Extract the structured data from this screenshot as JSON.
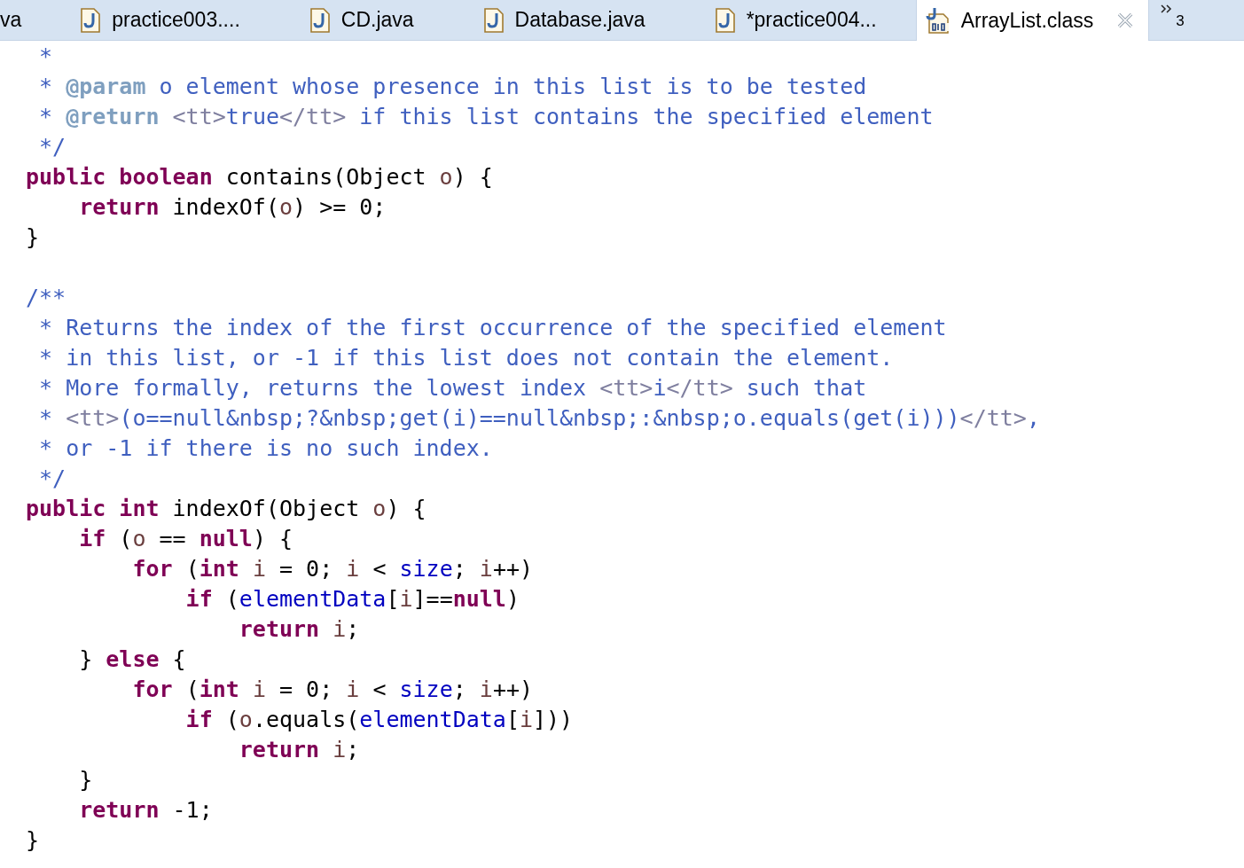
{
  "tabs": [
    {
      "label": "va",
      "kind": "cut",
      "selected": false
    },
    {
      "label": "practice003....",
      "kind": "java",
      "selected": false
    },
    {
      "label": "CD.java",
      "kind": "java",
      "selected": false
    },
    {
      "label": "Database.java",
      "kind": "java",
      "selected": false
    },
    {
      "label": "*practice004...",
      "kind": "java",
      "selected": false
    },
    {
      "label": "ArrayList.class",
      "kind": "class",
      "selected": true
    }
  ],
  "overflow": {
    "count": "3"
  },
  "editor": {
    "lines": [
      {
        "kind": "code",
        "tokens": [
          {
            "kind": "comment",
            "text": " *"
          }
        ]
      },
      {
        "kind": "code",
        "tokens": [
          {
            "kind": "comment",
            "text": " * "
          },
          {
            "kind": "doctag",
            "text": "@param"
          },
          {
            "kind": "comment",
            "text": " o element whose presence in this list is to be tested"
          }
        ]
      },
      {
        "kind": "code",
        "tokens": [
          {
            "kind": "comment",
            "text": " * "
          },
          {
            "kind": "doctag",
            "text": "@return"
          },
          {
            "kind": "html",
            "text": " <tt>"
          },
          {
            "kind": "comment",
            "text": "true"
          },
          {
            "kind": "html",
            "text": "</tt>"
          },
          {
            "kind": "comment",
            "text": " if this list contains the specified element"
          }
        ]
      },
      {
        "kind": "code",
        "tokens": [
          {
            "kind": "comment",
            "text": " */"
          }
        ]
      },
      {
        "kind": "code",
        "tokens": [
          {
            "kind": "keyword",
            "text": "public "
          },
          {
            "kind": "keyword",
            "text": "boolean"
          },
          {
            "kind": "plain",
            "text": " contains(Object "
          },
          {
            "kind": "local",
            "text": "o"
          },
          {
            "kind": "plain",
            "text": ") {"
          }
        ]
      },
      {
        "kind": "code",
        "tokens": [
          {
            "kind": "keyword",
            "text": "    return"
          },
          {
            "kind": "plain",
            "text": " indexOf("
          },
          {
            "kind": "local",
            "text": "o"
          },
          {
            "kind": "plain",
            "text": ") >= 0;"
          }
        ]
      },
      {
        "kind": "code",
        "tokens": [
          {
            "kind": "plain",
            "text": "}"
          }
        ]
      },
      {
        "kind": "blank"
      },
      {
        "kind": "code",
        "tokens": [
          {
            "kind": "comment",
            "text": "/**"
          }
        ]
      },
      {
        "kind": "code",
        "tokens": [
          {
            "kind": "comment",
            "text": " * Returns the index of the first occurrence of the specified element"
          }
        ]
      },
      {
        "kind": "code",
        "tokens": [
          {
            "kind": "comment",
            "text": " * in this list, or -1 if this list does not contain the element."
          }
        ]
      },
      {
        "kind": "code",
        "tokens": [
          {
            "kind": "comment",
            "text": " * More formally, returns the lowest index "
          },
          {
            "kind": "html",
            "text": "<tt>"
          },
          {
            "kind": "comment",
            "text": "i"
          },
          {
            "kind": "html",
            "text": "</tt>"
          },
          {
            "kind": "comment",
            "text": " such that"
          }
        ]
      },
      {
        "kind": "code",
        "tokens": [
          {
            "kind": "comment",
            "text": " * "
          },
          {
            "kind": "html",
            "text": "<tt>"
          },
          {
            "kind": "comment",
            "text": "(o==null&nbsp;?&nbsp;get(i)==null&nbsp;:&nbsp;o.equals(get(i)))"
          },
          {
            "kind": "html",
            "text": "</tt>"
          },
          {
            "kind": "comment",
            "text": ","
          }
        ]
      },
      {
        "kind": "code",
        "tokens": [
          {
            "kind": "comment",
            "text": " * or -1 if there is no such index."
          }
        ]
      },
      {
        "kind": "code",
        "tokens": [
          {
            "kind": "comment",
            "text": " */"
          }
        ]
      },
      {
        "kind": "code",
        "tokens": [
          {
            "kind": "keyword",
            "text": "public "
          },
          {
            "kind": "keyword",
            "text": "int"
          },
          {
            "kind": "plain",
            "text": " indexOf(Object "
          },
          {
            "kind": "local",
            "text": "o"
          },
          {
            "kind": "plain",
            "text": ") {"
          }
        ]
      },
      {
        "kind": "code",
        "tokens": [
          {
            "kind": "keyword",
            "text": "    if"
          },
          {
            "kind": "plain",
            "text": " ("
          },
          {
            "kind": "local",
            "text": "o"
          },
          {
            "kind": "plain",
            "text": " == "
          },
          {
            "kind": "keyword",
            "text": "null"
          },
          {
            "kind": "plain",
            "text": ") {"
          }
        ]
      },
      {
        "kind": "code",
        "tokens": [
          {
            "kind": "keyword",
            "text": "        for"
          },
          {
            "kind": "plain",
            "text": " ("
          },
          {
            "kind": "keyword",
            "text": "int"
          },
          {
            "kind": "local",
            "text": " i"
          },
          {
            "kind": "plain",
            "text": " = 0; "
          },
          {
            "kind": "local",
            "text": "i"
          },
          {
            "kind": "plain",
            "text": " < "
          },
          {
            "kind": "field",
            "text": "size"
          },
          {
            "kind": "plain",
            "text": "; "
          },
          {
            "kind": "local",
            "text": "i"
          },
          {
            "kind": "plain",
            "text": "++)"
          }
        ]
      },
      {
        "kind": "code",
        "tokens": [
          {
            "kind": "keyword",
            "text": "            if"
          },
          {
            "kind": "plain",
            "text": " ("
          },
          {
            "kind": "field",
            "text": "elementData"
          },
          {
            "kind": "plain",
            "text": "["
          },
          {
            "kind": "local",
            "text": "i"
          },
          {
            "kind": "plain",
            "text": "]=="
          },
          {
            "kind": "keyword",
            "text": "null"
          },
          {
            "kind": "plain",
            "text": ")"
          }
        ]
      },
      {
        "kind": "code",
        "tokens": [
          {
            "kind": "keyword",
            "text": "                return"
          },
          {
            "kind": "local",
            "text": " i"
          },
          {
            "kind": "plain",
            "text": ";"
          }
        ]
      },
      {
        "kind": "code",
        "tokens": [
          {
            "kind": "plain",
            "text": "    } "
          },
          {
            "kind": "keyword",
            "text": "else"
          },
          {
            "kind": "plain",
            "text": " {"
          }
        ]
      },
      {
        "kind": "code",
        "tokens": [
          {
            "kind": "keyword",
            "text": "        for"
          },
          {
            "kind": "plain",
            "text": " ("
          },
          {
            "kind": "keyword",
            "text": "int"
          },
          {
            "kind": "local",
            "text": " i"
          },
          {
            "kind": "plain",
            "text": " = 0; "
          },
          {
            "kind": "local",
            "text": "i"
          },
          {
            "kind": "plain",
            "text": " < "
          },
          {
            "kind": "field",
            "text": "size"
          },
          {
            "kind": "plain",
            "text": "; "
          },
          {
            "kind": "local",
            "text": "i"
          },
          {
            "kind": "plain",
            "text": "++)"
          }
        ]
      },
      {
        "kind": "code",
        "tokens": [
          {
            "kind": "keyword",
            "text": "            if"
          },
          {
            "kind": "plain",
            "text": " ("
          },
          {
            "kind": "local",
            "text": "o"
          },
          {
            "kind": "plain",
            "text": ".equals("
          },
          {
            "kind": "field",
            "text": "elementData"
          },
          {
            "kind": "plain",
            "text": "["
          },
          {
            "kind": "local",
            "text": "i"
          },
          {
            "kind": "plain",
            "text": "]))"
          }
        ]
      },
      {
        "kind": "code",
        "tokens": [
          {
            "kind": "keyword",
            "text": "                return"
          },
          {
            "kind": "local",
            "text": " i"
          },
          {
            "kind": "plain",
            "text": ";"
          }
        ]
      },
      {
        "kind": "code",
        "tokens": [
          {
            "kind": "plain",
            "text": "    }"
          }
        ]
      },
      {
        "kind": "code",
        "tokens": [
          {
            "kind": "keyword",
            "text": "    return"
          },
          {
            "kind": "plain",
            "text": " -1;"
          }
        ]
      },
      {
        "kind": "code",
        "tokens": [
          {
            "kind": "plain",
            "text": "}"
          }
        ]
      }
    ]
  }
}
